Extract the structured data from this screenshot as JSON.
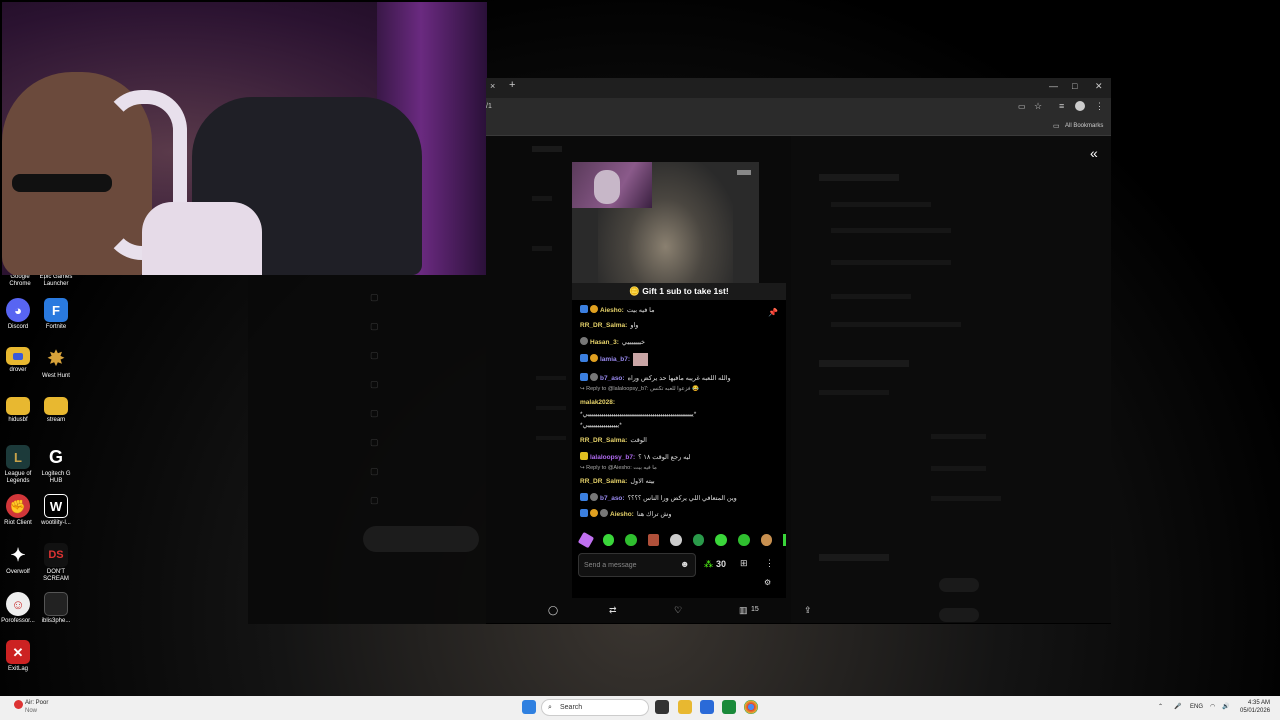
{
  "desktop": {
    "icons": [
      {
        "label": "Google Chrome",
        "glyph": ""
      },
      {
        "label": "Epic Games Launcher",
        "glyph": ""
      },
      {
        "label": "Discord",
        "glyph": "◕"
      },
      {
        "label": "Fortnite",
        "glyph": "F"
      },
      {
        "label": "drover",
        "glyph": ""
      },
      {
        "label": "West Hunt",
        "glyph": "✸"
      },
      {
        "label": "hidusbf",
        "glyph": ""
      },
      {
        "label": "stream",
        "glyph": ""
      },
      {
        "label": "League of Legends",
        "glyph": "L"
      },
      {
        "label": "Logitech G HUB",
        "glyph": "G"
      },
      {
        "label": "Riot Client",
        "glyph": "✊"
      },
      {
        "label": "wootility-l...",
        "glyph": "W"
      },
      {
        "label": "Overwolf",
        "glyph": "✦"
      },
      {
        "label": "DON'T SCREAM",
        "glyph": "DS"
      },
      {
        "label": "Porofessor...",
        "glyph": "☺"
      },
      {
        "label": "iblis3phe...",
        "glyph": ""
      },
      {
        "label": "ExitLag",
        "glyph": "✕"
      }
    ]
  },
  "browser": {
    "url_fragment": "/1",
    "new_tab": "+",
    "close_tab": "×",
    "bookmarks_label": "All Bookmarks"
  },
  "page": {
    "gift_banner": "🪙 Gift 1 sub to take 1st!",
    "chat": [
      {
        "user": "Aiesho:",
        "text": "ما فيه بيت",
        "color": "#e7d36a"
      },
      {
        "user": "RR_DR_Salma:",
        "text": "واو",
        "color": "#e7d36a"
      },
      {
        "user": "Hasan_3:",
        "text": "خيييييييي",
        "color": "#e7d36a"
      },
      {
        "user": "lamia_b7:",
        "text": "",
        "color": "#9a8af0"
      },
      {
        "user": "b7_aso:",
        "text": "والله اللعبه غريبه مافيها حد يركض وراه",
        "color": "#9a8af0"
      },
      {
        "user": "malak2028:",
        "text": "",
        "color": "#e7d36a"
      },
      {
        "user": "RR_DR_Salma:",
        "text": "الوقت",
        "color": "#e7d36a"
      },
      {
        "user": "lalaloopsy_b7:",
        "text": "ليه رجع الوقت ١٨ ؟",
        "color": "#b06af0"
      },
      {
        "user": "RR_DR_Salma:",
        "text": "بيته الاول",
        "color": "#e7d36a"
      },
      {
        "user": "b7_aso:",
        "text": "وين المتعافي اللي يركض ورا الناس ؟؟؟؟",
        "color": "#9a8af0"
      },
      {
        "user": "Aiesho:",
        "text": "وش تراك هنا",
        "color": "#e7d36a"
      }
    ],
    "replies": [
      "↪ Reply to @lalaloopsy_b7: فزعوا للعبه تكنس 😂",
      "↪ Reply to @Aiesho: ما فيه بيت"
    ],
    "spam_line_1": "*ييييييييييييييييييييييييييييييييييييييييييييييييييييييي*",
    "spam_line_2": "*ييييييييييييييييي*",
    "input_placeholder": "Send a message",
    "coins": "30",
    "stats_count": "15",
    "colors": {
      "gold": "#e7d36a",
      "purple": "#9a8af0",
      "kick_green": "#53fc18"
    }
  },
  "taskbar": {
    "weather_title": "Air: Poor",
    "weather_sub": "Now",
    "search_placeholder": "Search",
    "lang": "ENG",
    "time": "4:35 AM",
    "date": "05/01/2026"
  }
}
